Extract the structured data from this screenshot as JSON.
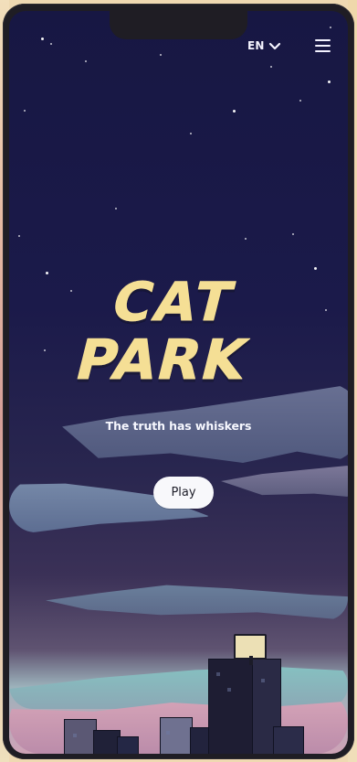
{
  "brand": {
    "line_1": "CAT",
    "line_2": "PARK"
  },
  "header": {
    "language": "EN",
    "chevron_icon": "chevron-down-icon",
    "menu_icon": "hamburger-menu-icon"
  },
  "hero": {
    "tagline": "The truth has whiskers",
    "play_label": "Play"
  },
  "colors": {
    "logo": "#f5df95",
    "night": "#1b1a4a",
    "button": "#f8f8fb"
  }
}
